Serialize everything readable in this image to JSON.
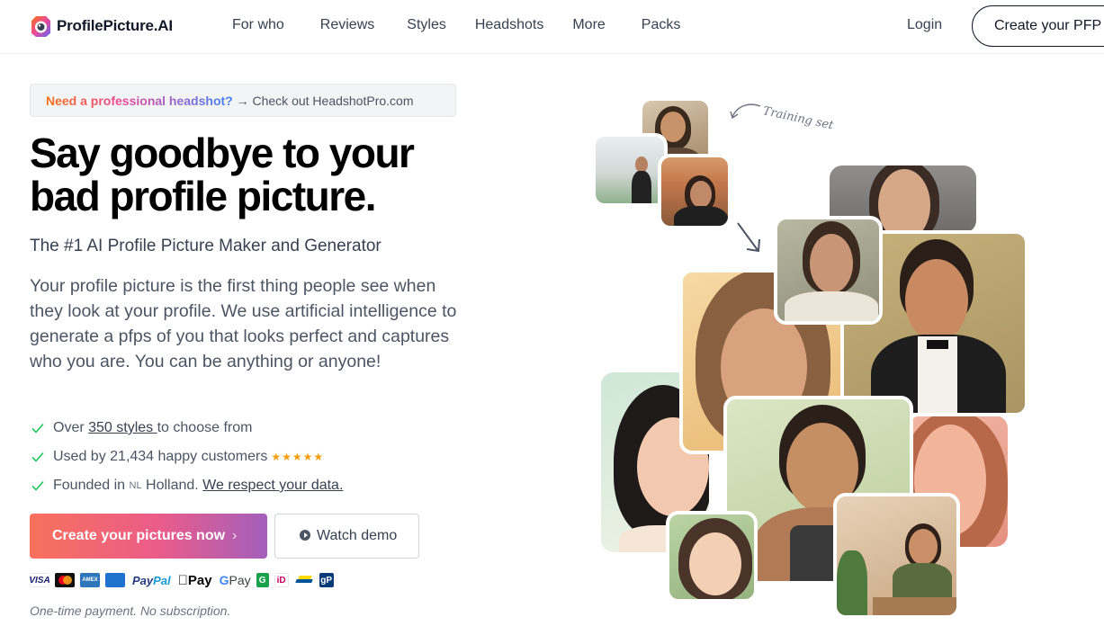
{
  "nav": {
    "logo_text": "ProfilePicture.AI",
    "links": [
      "For who",
      "Reviews",
      "Styles",
      "Headshots",
      "More",
      "Packs"
    ],
    "login": "Login",
    "cta": "Create your PFP"
  },
  "banner": {
    "highlight": "Need a professional headshot?",
    "rest": " → Check out HeadshotPro.com"
  },
  "hero": {
    "headline": "Say goodbye to your bad profile picture.",
    "subhead": "The #1 AI Profile Picture Maker and Generator",
    "paragraph": "Your profile picture is the first thing people see when they look at your profile. We use artificial intelligence to generate a pfps of you that looks perfect and captures who you are. You can be anything or anyone!"
  },
  "features": {
    "f1_pre": "Over ",
    "f1_link": "350 styles ",
    "f1_post": "to choose from",
    "f2_text": "Used by 21,434 happy customers",
    "f2_stars": "★★★★★",
    "f3_pre": "Founded in ",
    "f3_flag": "NL",
    "f3_mid": " Holland. ",
    "f3_link": "We respect your data."
  },
  "buttons": {
    "primary": "Create your pictures now",
    "primary_chevron": "›",
    "secondary": "Watch demo"
  },
  "payments": {
    "visa": "VISA",
    "amex": "AMEX",
    "paypal_a": "Pay",
    "paypal_b": "Pal",
    "apple": "Pay",
    "google_g": "G",
    "google_pay": " Pay",
    "green": "G",
    "ideal": "iD",
    "gp": "gP"
  },
  "note": "One-time payment. No subscription.",
  "collage": {
    "training_label": "Training set"
  },
  "colors": {
    "brand_gradient_start": "#f8715b",
    "brand_gradient_end": "#a35fbd",
    "check_green": "#22c55e",
    "star_gold": "#f59e0b"
  }
}
